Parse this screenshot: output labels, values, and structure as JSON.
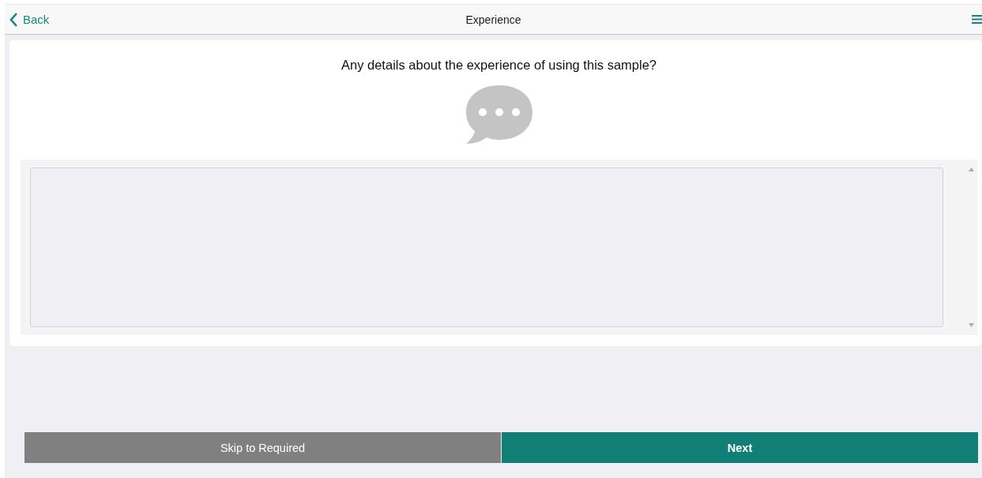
{
  "header": {
    "back": "Back",
    "title": "Experience"
  },
  "question": {
    "text": "Any details about the experience of using this sample?"
  },
  "buttons": [
    {
      "kind": "secondary",
      "label": "Skip to Required"
    },
    {
      "kind": "primary",
      "label": "Next"
    }
  ]
}
